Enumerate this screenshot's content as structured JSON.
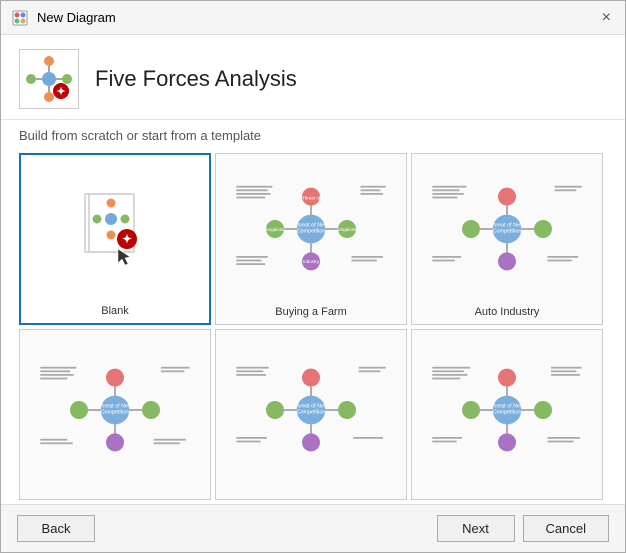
{
  "titleBar": {
    "icon": "diagram-icon",
    "title": "New Diagram",
    "closeLabel": "×"
  },
  "header": {
    "title": "Five Forces Analysis",
    "subtitle": "Build from scratch or start from a template"
  },
  "footer": {
    "backLabel": "Back",
    "nextLabel": "Next",
    "cancelLabel": "Cancel"
  },
  "templates": [
    {
      "id": "blank",
      "label": "Blank",
      "selected": true
    },
    {
      "id": "buying-farm",
      "label": "Buying a Farm",
      "selected": false
    },
    {
      "id": "auto-industry",
      "label": "Auto Industry",
      "selected": false
    },
    {
      "id": "template-4",
      "label": "",
      "selected": false
    },
    {
      "id": "template-5",
      "label": "",
      "selected": false
    },
    {
      "id": "template-6",
      "label": "",
      "selected": false
    }
  ]
}
